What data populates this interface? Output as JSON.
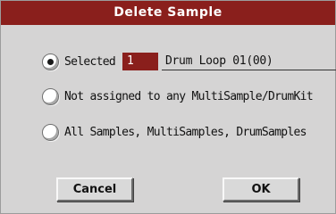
{
  "dialog": {
    "title": "Delete Sample",
    "options": [
      {
        "label": "Selected",
        "checked": true
      },
      {
        "label": "Not assigned to any MultiSample/DrumKit",
        "checked": false
      },
      {
        "label": "All Samples, MultiSamples, DrumSamples",
        "checked": false
      }
    ],
    "selected_index": "1",
    "sample_name": "Drum Loop 01(00)",
    "buttons": {
      "cancel_label": "Cancel",
      "ok_label": "OK"
    }
  },
  "colors": {
    "title_bar": "#8a1f1c",
    "background": "#d5d4d4",
    "index_field": "#8a1f1c"
  }
}
